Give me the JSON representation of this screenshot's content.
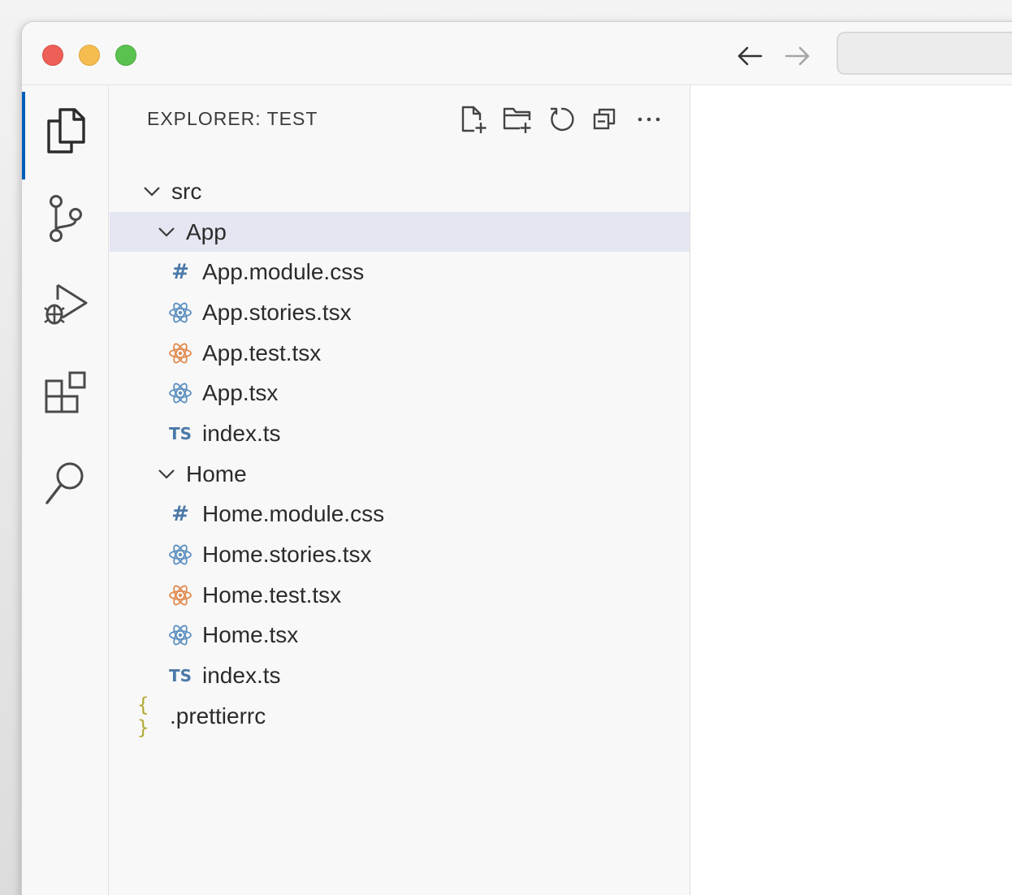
{
  "window": {
    "title": ""
  },
  "titlebar": {
    "back_icon": "arrow-left-icon",
    "forward_icon": "arrow-right-icon",
    "command_center_text": ""
  },
  "activity_bar": {
    "items": [
      {
        "name": "explorer",
        "icon": "files-icon",
        "active": true
      },
      {
        "name": "source-control",
        "icon": "source-control-icon",
        "active": false
      },
      {
        "name": "run-and-debug",
        "icon": "run-debug-icon",
        "active": false
      },
      {
        "name": "extensions",
        "icon": "extensions-icon",
        "active": false
      },
      {
        "name": "search",
        "icon": "search-icon",
        "active": false
      }
    ]
  },
  "sidebar": {
    "title": "EXPLORER: TEST",
    "actions": [
      {
        "name": "new-file",
        "icon": "new-file-icon"
      },
      {
        "name": "new-folder",
        "icon": "new-folder-icon"
      },
      {
        "name": "refresh",
        "icon": "refresh-icon"
      },
      {
        "name": "collapse-all",
        "icon": "collapse-all-icon"
      },
      {
        "name": "more-actions",
        "icon": "ellipsis-icon"
      }
    ]
  },
  "tree": {
    "src": "src",
    "app_folder": "App",
    "app_files": [
      {
        "label": "App.module.css",
        "type": "css"
      },
      {
        "label": "App.stories.tsx",
        "type": "react"
      },
      {
        "label": "App.test.tsx",
        "type": "react-test"
      },
      {
        "label": "App.tsx",
        "type": "react"
      },
      {
        "label": "index.ts",
        "type": "ts"
      }
    ],
    "home_folder": "Home",
    "home_files": [
      {
        "label": "Home.module.css",
        "type": "css"
      },
      {
        "label": "Home.stories.tsx",
        "type": "react"
      },
      {
        "label": "Home.test.tsx",
        "type": "react-test"
      },
      {
        "label": "Home.tsx",
        "type": "react"
      },
      {
        "label": "index.ts",
        "type": "ts"
      }
    ],
    "root_files": [
      {
        "label": ".prettierrc",
        "type": "json"
      }
    ],
    "css_glyph": "#",
    "ts_glyph": "TS",
    "json_glyph": "{ }"
  },
  "colors": {
    "selection": "#e4e6f1",
    "active_indicator": "#005fb8",
    "react_icon": "#5c8fc0",
    "react_test_icon": "#e08a4e",
    "css_icon": "#4b79a8",
    "ts_icon": "#4b79a8",
    "json_icon": "#b2ab34"
  }
}
